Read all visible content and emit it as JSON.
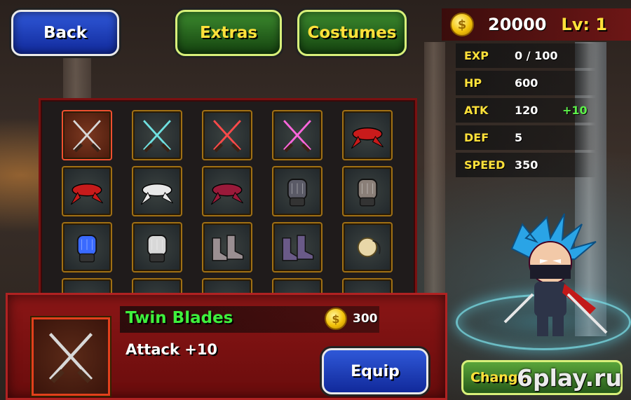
{
  "nav": {
    "back_label": "Back",
    "extras_label": "Extras",
    "costumes_label": "Costumes"
  },
  "player": {
    "gold": "20000",
    "level_label": "Lv: 1"
  },
  "stats": [
    {
      "name": "EXP",
      "value": "0 / 100",
      "bonus": ""
    },
    {
      "name": "HP",
      "value": "600",
      "bonus": ""
    },
    {
      "name": "ATK",
      "value": "120",
      "bonus": "+10"
    },
    {
      "name": "DEF",
      "value": "5",
      "bonus": ""
    },
    {
      "name": "SPEED",
      "value": "350",
      "bonus": ""
    }
  ],
  "inventory": {
    "slots": [
      {
        "icon": "twin-blades-icon",
        "tint": "#d8d8d8",
        "selected": true
      },
      {
        "icon": "cyan-blades-icon",
        "tint": "#6fe0e0",
        "selected": false
      },
      {
        "icon": "red-blades-icon",
        "tint": "#ff4a4a",
        "selected": false
      },
      {
        "icon": "pink-blades-icon",
        "tint": "#ff66dd",
        "selected": false
      },
      {
        "icon": "red-headband-icon",
        "tint": "#c81b1b",
        "selected": false
      },
      {
        "icon": "red-scarf-icon",
        "tint": "#c81b1b",
        "selected": false
      },
      {
        "icon": "white-scarf-icon",
        "tint": "#e8e8e8",
        "selected": false
      },
      {
        "icon": "crimson-scarf-icon",
        "tint": "#9a1a3a",
        "selected": false
      },
      {
        "icon": "dark-glove-icon",
        "tint": "#5a5a66",
        "selected": false
      },
      {
        "icon": "armored-glove-icon",
        "tint": "#8a7f78",
        "selected": false
      },
      {
        "icon": "blue-gauntlet-icon",
        "tint": "#3a6aff",
        "selected": false
      },
      {
        "icon": "white-gauntlet-icon",
        "tint": "#d8d8d8",
        "selected": false
      },
      {
        "icon": "grey-boots-icon",
        "tint": "#9a8f92",
        "selected": false
      },
      {
        "icon": "purple-boots-icon",
        "tint": "#6a5a88",
        "selected": false
      },
      {
        "icon": "bead-necklace-icon",
        "tint": "#e8d7a8",
        "selected": false
      }
    ]
  },
  "selected_item": {
    "icon": "twin-blades-icon",
    "name": "Twin Blades",
    "price": "300",
    "effect": "Attack +10",
    "equip_label": "Equip"
  },
  "change_label": "Change",
  "watermark": "6play.ru",
  "colors": {
    "gold_text": "#ffe13a",
    "item_name": "#3ff03c",
    "bonus": "#5df04a",
    "panel_red": "#8a1616",
    "button_blue": "#2f58d8",
    "button_green": "#3c8a2e"
  }
}
